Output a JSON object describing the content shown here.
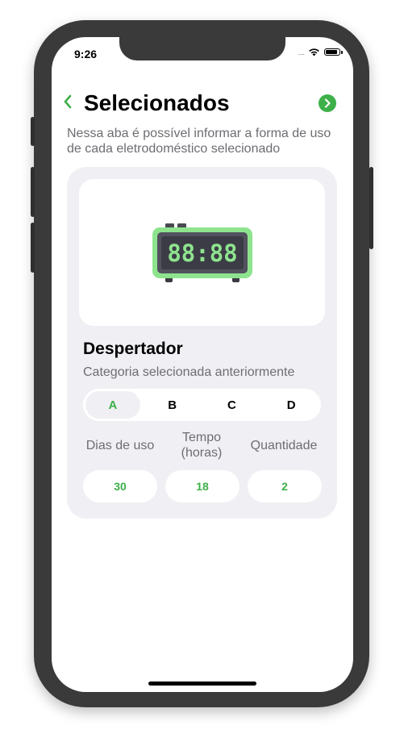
{
  "status_bar": {
    "time": "9:26",
    "signal": "....."
  },
  "header": {
    "back_icon": "chevron-left-icon",
    "title": "Selecionados",
    "next_icon": "chevron-right-circle-icon"
  },
  "subtitle": "Nessa aba é possível informar a forma de uso de cada eletrodoméstico selecionado",
  "appliance": {
    "image_icon": "alarm-clock-icon",
    "clock_display": "88:88",
    "name": "Despertador",
    "category_label": "Categoria selecionada anteriormente",
    "categories": [
      "A",
      "B",
      "C",
      "D"
    ],
    "selected_category": "A"
  },
  "usage": {
    "days_label": "Dias de uso",
    "time_label": "Tempo\n(horas)",
    "quantity_label": "Quantidade",
    "days_value": "30",
    "time_value": "18",
    "quantity_value": "2"
  },
  "colors": {
    "accent": "#3eb049",
    "card_bg": "#f0f0f4",
    "secondary_text": "#6d6d72",
    "clock_green": "#8ee48e"
  }
}
